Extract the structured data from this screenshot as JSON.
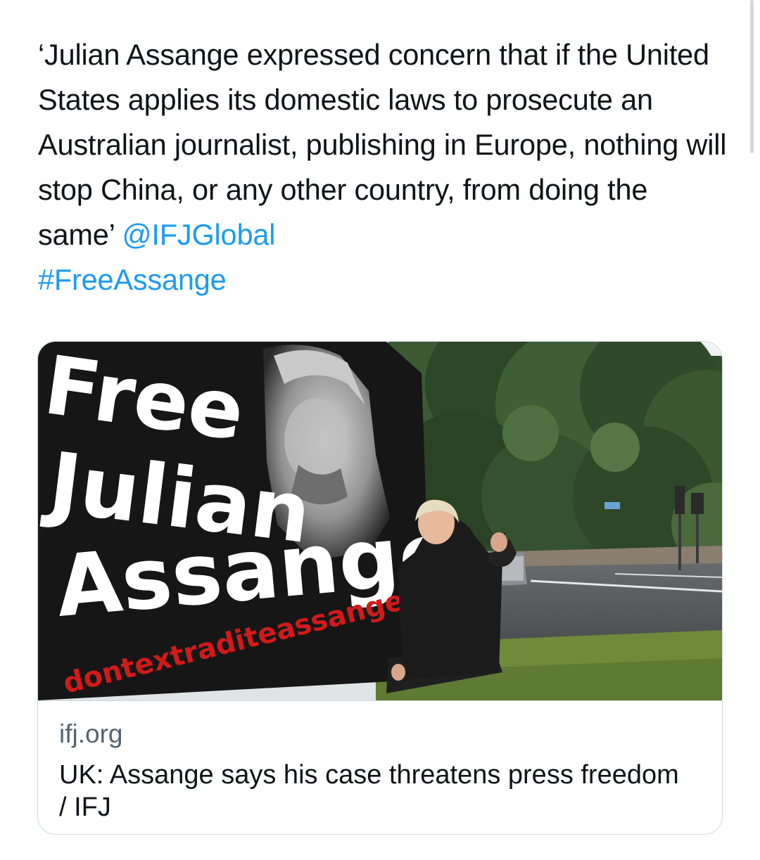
{
  "tweet": {
    "text_segments": [
      {
        "text": "‘Julian Assange expressed concern that if the United States applies its domestic laws to prosecute an Australian journalist, publishing in Europe, nothing will stop China, or any other country, from doing the same’ ",
        "type": "plain"
      },
      {
        "text": "@IFJGlobal",
        "type": "mention"
      },
      {
        "text": "#FreeAssange",
        "type": "hashtag"
      }
    ]
  },
  "card": {
    "image": {
      "billboard_lines": [
        "Free",
        "Julian",
        "Assange"
      ],
      "billboard_url": "dontextraditeassange.com",
      "colors": {
        "billboard": "#161616",
        "text": "#ffffff",
        "url": "#d11a1a",
        "trees": "#2f4a2a",
        "grass": "#6f8a3a",
        "road": "#5a5c5e",
        "sky": "#e8ecef"
      }
    },
    "domain": "ifj.org",
    "title": "UK: Assange says his case threatens press freedom / IFJ"
  },
  "colors": {
    "link": "#1d9bf0",
    "text": "#0f1419",
    "muted": "#536471",
    "border": "#cfd9de"
  }
}
